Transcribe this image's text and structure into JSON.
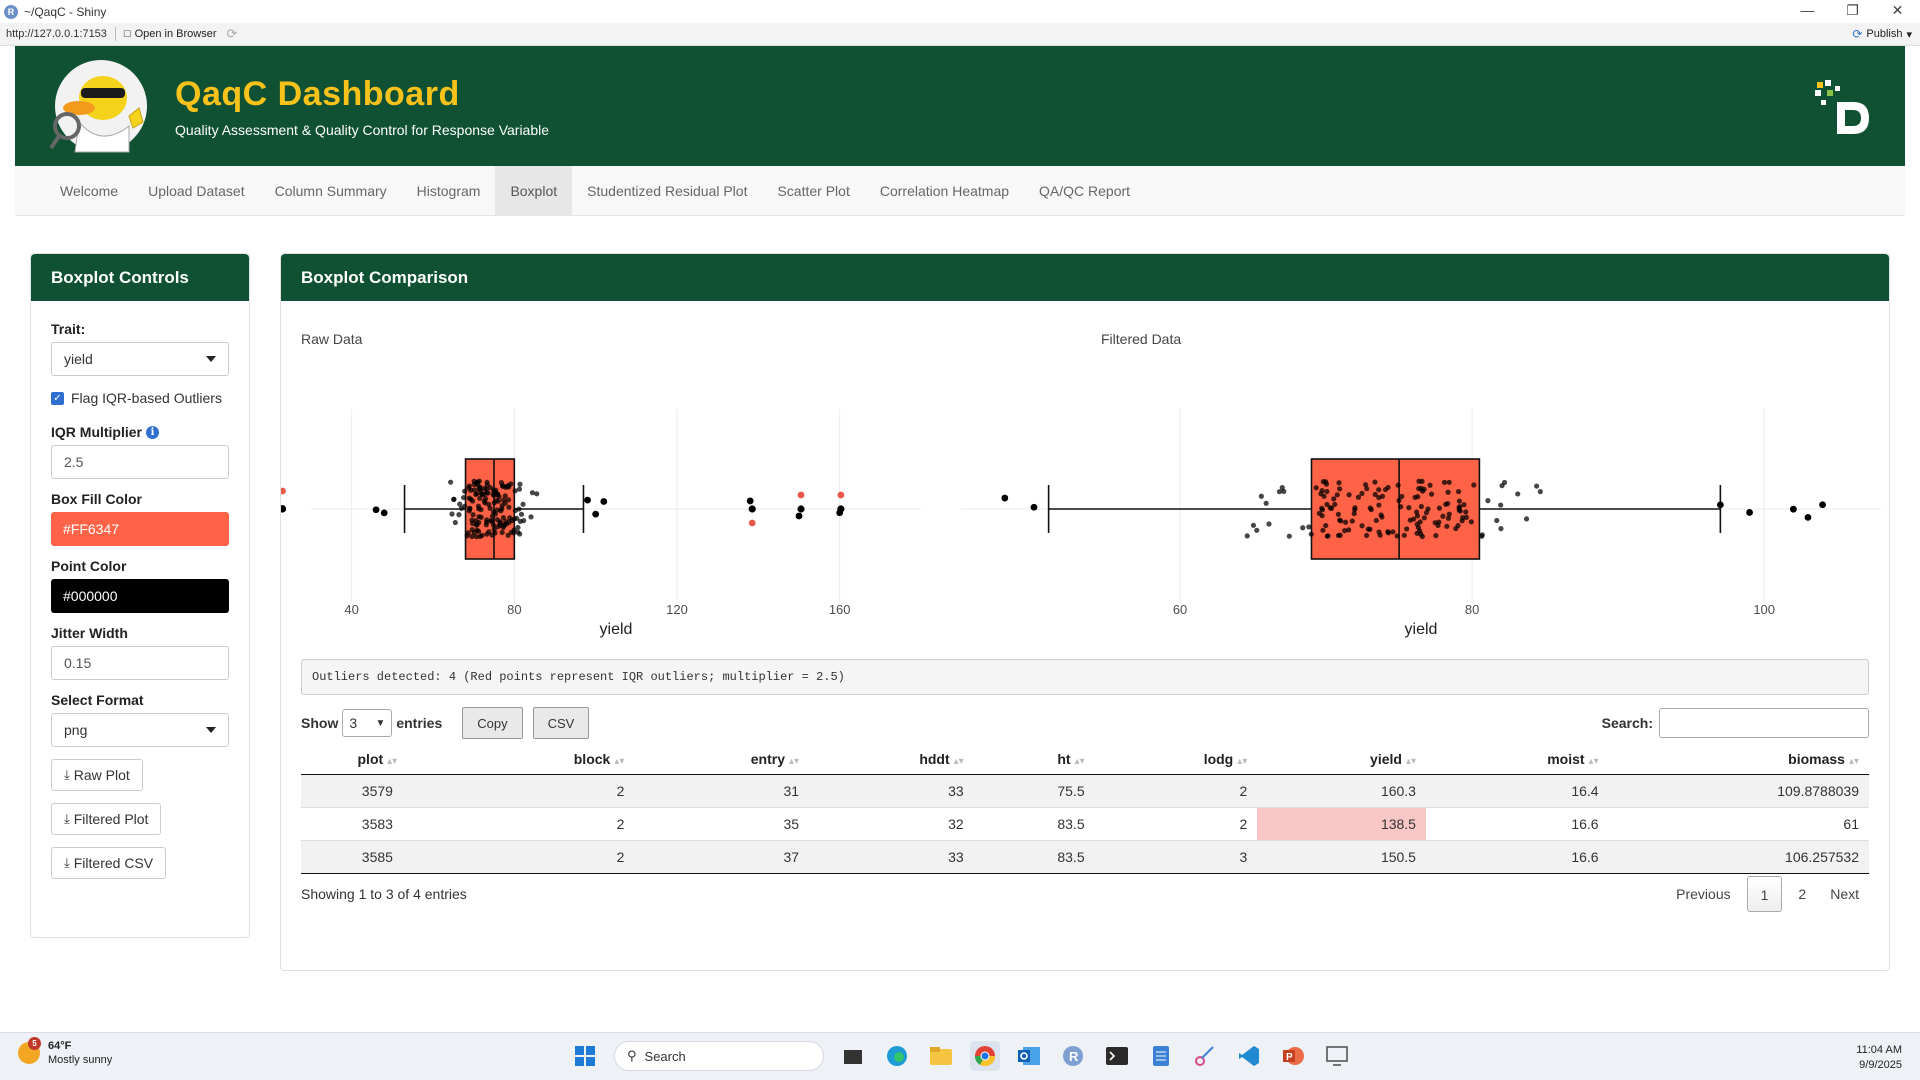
{
  "window": {
    "title": "~/QaqC - Shiny",
    "url": "http://127.0.0.1:7153",
    "open_in_browser": "Open in Browser",
    "publish": "Publish"
  },
  "header": {
    "title": "QaqC Dashboard",
    "subtitle": "Quality Assessment & Quality Control for Response Variable"
  },
  "nav": {
    "tabs": [
      "Welcome",
      "Upload Dataset",
      "Column Summary",
      "Histogram",
      "Boxplot",
      "Studentized Residual Plot",
      "Scatter Plot",
      "Correlation Heatmap",
      "QA/QC Report"
    ],
    "active": "Boxplot"
  },
  "sidebar": {
    "title": "Boxplot Controls",
    "trait_label": "Trait:",
    "trait_value": "yield",
    "flag_label": "Flag IQR-based Outliers",
    "flag_checked": true,
    "iqr_label": "IQR Multiplier",
    "iqr_value": "2.5",
    "box_fill_label": "Box Fill Color",
    "box_fill_value": "#FF6347",
    "point_color_label": "Point Color",
    "point_color_value": "#000000",
    "jitter_label": "Jitter Width",
    "jitter_value": "0.15",
    "format_label": "Select Format",
    "format_value": "png",
    "btn_raw": "Raw Plot",
    "btn_filtered": "Filtered Plot",
    "btn_csv": "Filtered CSV"
  },
  "main": {
    "title": "Boxplot Comparison",
    "outlier_message": "Outliers detected: 4 (Red points represent IQR outliers; multiplier = 2.5)"
  },
  "colors": {
    "header_bg": "#0f5132",
    "title_yellow": "#f9c21b",
    "box_fill": "#FF6347",
    "outlier": "#e8594a",
    "highlight_cell": "#f9c6c6"
  },
  "chart_data": [
    {
      "type": "boxplot",
      "title": "Raw Data",
      "xlabel": "yield",
      "orientation": "horizontal",
      "xlim": [
        30,
        180
      ],
      "xticks": [
        40,
        80,
        120,
        160
      ],
      "grid": true,
      "box": {
        "whisker_low": 53,
        "q1": 68,
        "median": 75,
        "q3": 80,
        "whisker_high": 97
      },
      "outliers": [
        {
          "x": 23,
          "y": 0.45,
          "flag": true
        },
        {
          "x": 138.5,
          "y": -0.35,
          "flag": true
        },
        {
          "x": 150.5,
          "y": 0.35,
          "flag": true
        },
        {
          "x": 160.3,
          "y": 0.35,
          "flag": true
        }
      ],
      "extremes": [
        23,
        46,
        48,
        98,
        100,
        102,
        138,
        150,
        160
      ]
    },
    {
      "type": "boxplot",
      "title": "Filtered Data",
      "xlabel": "yield",
      "orientation": "horizontal",
      "xlim": [
        45,
        108
      ],
      "xticks": [
        60,
        80,
        100
      ],
      "grid": true,
      "box": {
        "whisker_low": 51,
        "q1": 69,
        "median": 75,
        "q3": 80.5,
        "whisker_high": 97
      },
      "extremes": [
        48,
        50,
        97,
        99,
        102,
        103,
        104
      ]
    }
  ],
  "table": {
    "show_label": "Show",
    "length_value": "3",
    "entries_label": "entries",
    "btn_copy": "Copy",
    "btn_csv": "CSV",
    "search_label": "Search:",
    "columns": [
      "plot",
      "block",
      "entry",
      "hddt",
      "ht",
      "lodg",
      "yield",
      "moist",
      "biomass"
    ],
    "rows": [
      [
        "3579",
        "2",
        "31",
        "33",
        "75.5",
        "2",
        "160.3",
        "16.4",
        "109.8788039"
      ],
      [
        "3583",
        "2",
        "35",
        "32",
        "83.5",
        "2",
        "138.5",
        "16.6",
        "61"
      ],
      [
        "3585",
        "2",
        "37",
        "33",
        "83.5",
        "3",
        "150.5",
        "16.6",
        "106.257532"
      ]
    ],
    "highlight_column": "yield",
    "info": "Showing 1 to 3 of 4 entries",
    "pager": {
      "previous": "Previous",
      "pages": [
        "1",
        "2"
      ],
      "current": "1",
      "next": "Next"
    }
  },
  "taskbar": {
    "temp": "64°F",
    "weather": "Mostly sunny",
    "weather_badge": "5",
    "search_placeholder": "Search",
    "time": "11:04 AM",
    "date": "9/9/2025"
  }
}
